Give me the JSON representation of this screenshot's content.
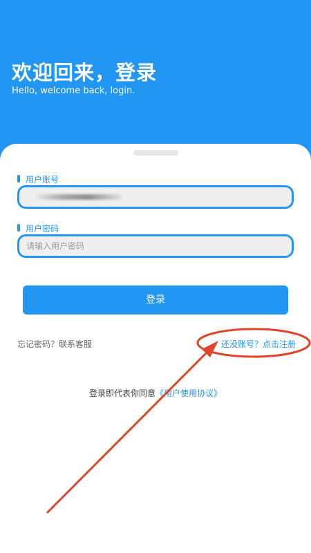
{
  "header": {
    "title": "欢迎回来，登录",
    "subtitle": "Hello, welcome back, login."
  },
  "form": {
    "account_label": "用户账号",
    "account_value": "",
    "password_label": "用户密码",
    "password_placeholder": "请输入用户密码",
    "login_button": "登录"
  },
  "links": {
    "forgot": "忘记密码？联系客服",
    "register": "还没账号？点击注册"
  },
  "agreement": {
    "prefix": "登录即代表你同意",
    "link": "《用户使用协议》"
  },
  "colors": {
    "primary": "#2196f3",
    "annotation": "#e0452b"
  }
}
